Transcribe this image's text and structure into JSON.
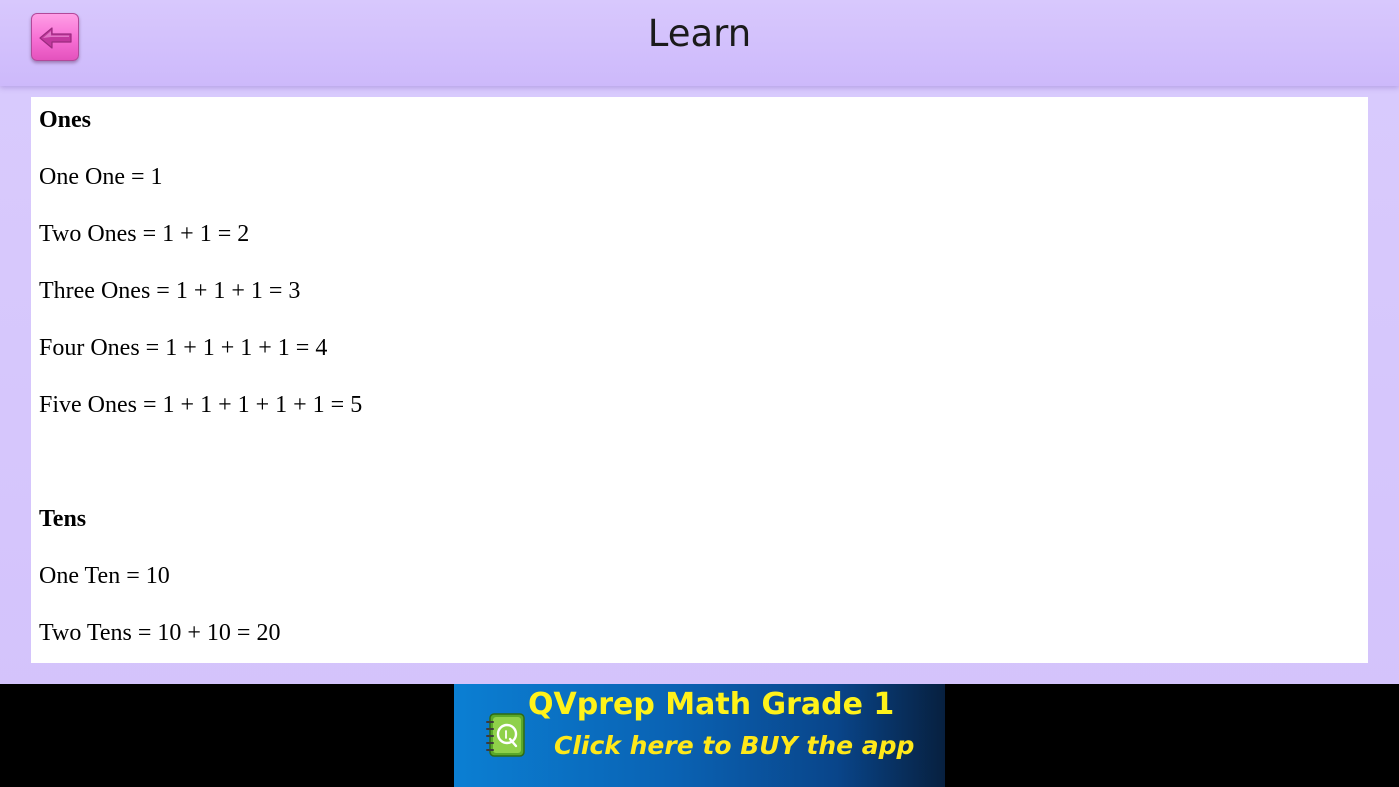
{
  "header": {
    "title": "Learn",
    "back_icon": "back-arrow-icon"
  },
  "lesson": {
    "ones": {
      "heading": "Ones",
      "lines": [
        "One One = 1",
        "Two Ones = 1 + 1 = 2",
        "Three Ones = 1 + 1 + 1 = 3",
        "Four Ones = 1 + 1 + 1 + 1 = 4",
        "Five Ones = 1 + 1 + 1 + 1 + 1 = 5"
      ]
    },
    "tens": {
      "heading": "Tens",
      "lines": [
        "One Ten = 10",
        "Two Tens = 10 + 10 = 20"
      ]
    }
  },
  "ad": {
    "title": "QVprep Math Grade 1",
    "subtitle": "Click here to BUY the app",
    "logo_icon": "qvprep-notebook-logo-icon"
  },
  "colors": {
    "background": "#d3c3fb",
    "header": "#cdb9fb",
    "back_button": "#f76fd4",
    "ad_text": "#fff21a",
    "ad_background": "#0a62b3"
  }
}
